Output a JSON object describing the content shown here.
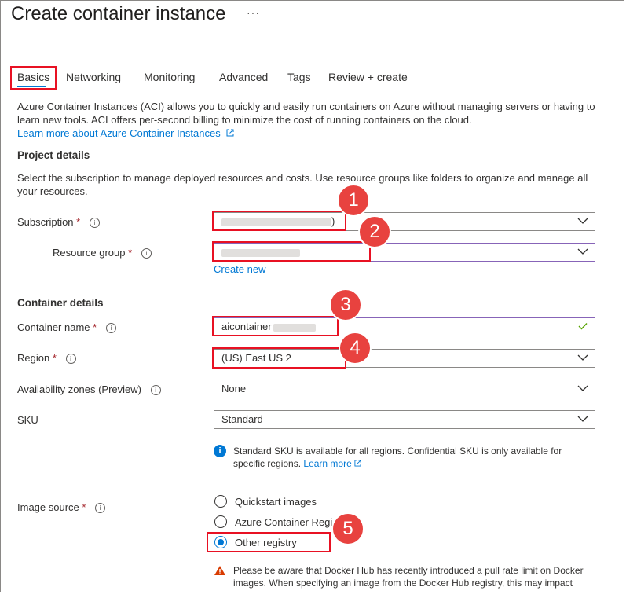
{
  "page": {
    "title": "Create container instance",
    "more": "···"
  },
  "tabs": [
    "Basics",
    "Networking",
    "Monitoring",
    "Advanced",
    "Tags",
    "Review + create"
  ],
  "intro": {
    "line1": "Azure Container Instances (ACI) allows you to quickly and easily run containers on Azure without managing servers or having to",
    "line2": "learn new tools. ACI offers per-second billing to minimize the cost of running containers on the cloud.",
    "learn_more": "Learn more about Azure Container Instances"
  },
  "project": {
    "heading": "Project details",
    "desc1": "Select the subscription to manage deployed resources and costs. Use resource groups like folders to organize and manage all",
    "desc2": "your resources.",
    "subscription_label": "Subscription",
    "subscription_value_suffix": ")",
    "resource_group_label": "Resource group",
    "create_new": "Create new"
  },
  "container": {
    "heading": "Container details",
    "name_label": "Container name",
    "name_value": "aicontainer",
    "region_label": "Region",
    "region_value": "(US) East US 2",
    "zones_label": "Availability zones (Preview)",
    "zones_value": "None",
    "sku_label": "SKU",
    "sku_value": "Standard",
    "sku_note1": "Standard SKU is available for all regions. Confidential SKU is only available for",
    "sku_note2": "specific regions.",
    "sku_learn_more": "Learn more"
  },
  "image": {
    "label": "Image source",
    "options": [
      "Quickstart images",
      "Azure Container Regi",
      "Other registry"
    ],
    "selected": "Other registry",
    "warning1": "Please be aware that Docker Hub has recently introduced a pull rate limit on Docker",
    "warning2": "images. When specifying an image from the Docker Hub registry, this may impact"
  },
  "markers": [
    "1",
    "2",
    "3",
    "4",
    "5"
  ],
  "required_mark": "*",
  "info_glyph": "i",
  "colors": {
    "accent": "#0078d4",
    "highlight": "#e81123",
    "badge": "#e8423f",
    "required": "#a4262c",
    "valid": "#57a300",
    "warning": "#d83b01"
  }
}
